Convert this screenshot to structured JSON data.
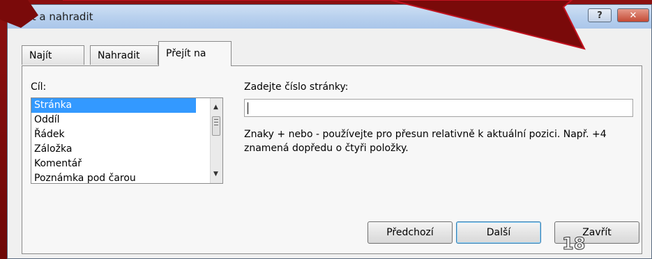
{
  "window": {
    "title": "Najít a nahradit",
    "help_glyph": "?",
    "close_glyph": "✕"
  },
  "tabs": [
    {
      "label": "Najít",
      "accel": "j"
    },
    {
      "label": "Nahradit",
      "accel": "d"
    },
    {
      "label": "Přejít na",
      "accel": "e",
      "active": true
    }
  ],
  "goto": {
    "target_label": "Cíl:",
    "items": [
      "Stránka",
      "Oddíl",
      "Řádek",
      "Záložka",
      "Komentář",
      "Poznámka pod čarou"
    ],
    "selected_item": "Stránka",
    "page_number_label": "Zadejte číslo stránky:",
    "page_number_value": "",
    "hint": "Znaky + nebo - používejte pro přesun relativně k aktuální pozici. Např. +4 znamená dopředu o čtyři položky."
  },
  "buttons": {
    "previous": "Předchozí",
    "next": "Další",
    "close": "Zavřít"
  },
  "slide": {
    "page_number": "18"
  },
  "colors": {
    "selection": "#3399ff",
    "slide_background": "#7a0a0a",
    "callout_outline": "#c1121f"
  }
}
